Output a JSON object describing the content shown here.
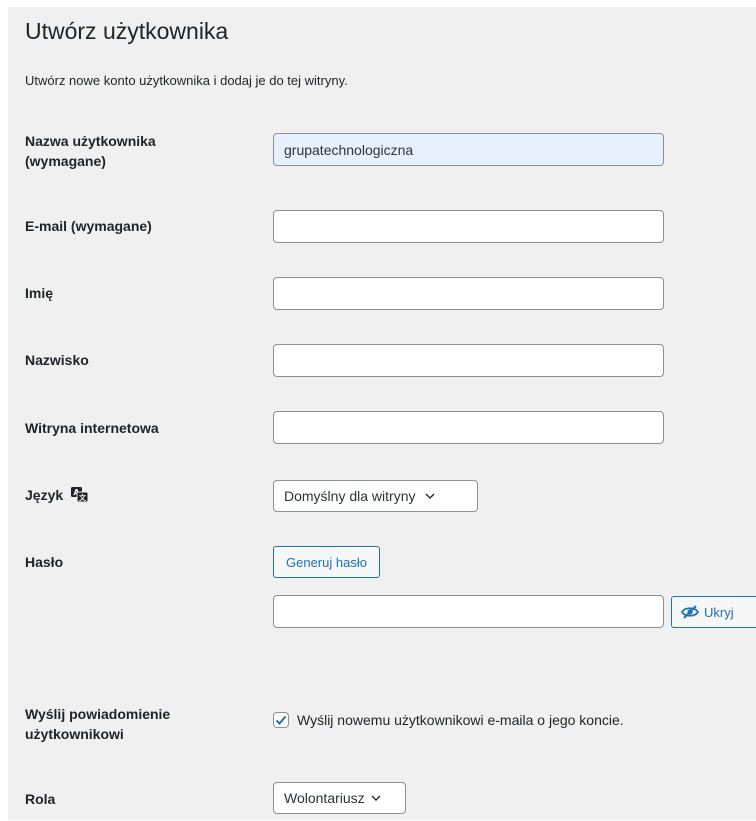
{
  "page": {
    "title": "Utwórz użytkownika",
    "description": "Utwórz nowe konto użytkownika i dodaj je do tej witryny."
  },
  "form": {
    "username": {
      "label": "Nazwa użytkownika",
      "label_suffix": "(wymagane)",
      "value": "grupatechnologiczna"
    },
    "email": {
      "label": "E-mail (wymagane)",
      "value": ""
    },
    "first_name": {
      "label": "Imię",
      "value": ""
    },
    "last_name": {
      "label": "Nazwisko",
      "value": ""
    },
    "website": {
      "label": "Witryna internetowa",
      "value": ""
    },
    "language": {
      "label": "Język",
      "icon": "translation-icon",
      "selected": "Domyślny dla witryny"
    },
    "password": {
      "label": "Hasło",
      "generate_label": "Generuj hasło",
      "value": "",
      "hide_label": "Ukryj",
      "hide_icon": "eye-slash-icon"
    },
    "notify": {
      "label_line1": "Wyślij powiadomienie",
      "label_line2": "użytkownikowi",
      "checkbox_label": "Wyślij nowemu użytkownikowi e-maila o jego koncie.",
      "checked": true
    },
    "role": {
      "label": "Rola",
      "selected": "Wolontariusz"
    }
  },
  "colors": {
    "accent": "#2271b1",
    "background": "#f0f0f1",
    "text": "#1d2327",
    "autofill": "#e8f0fe"
  }
}
